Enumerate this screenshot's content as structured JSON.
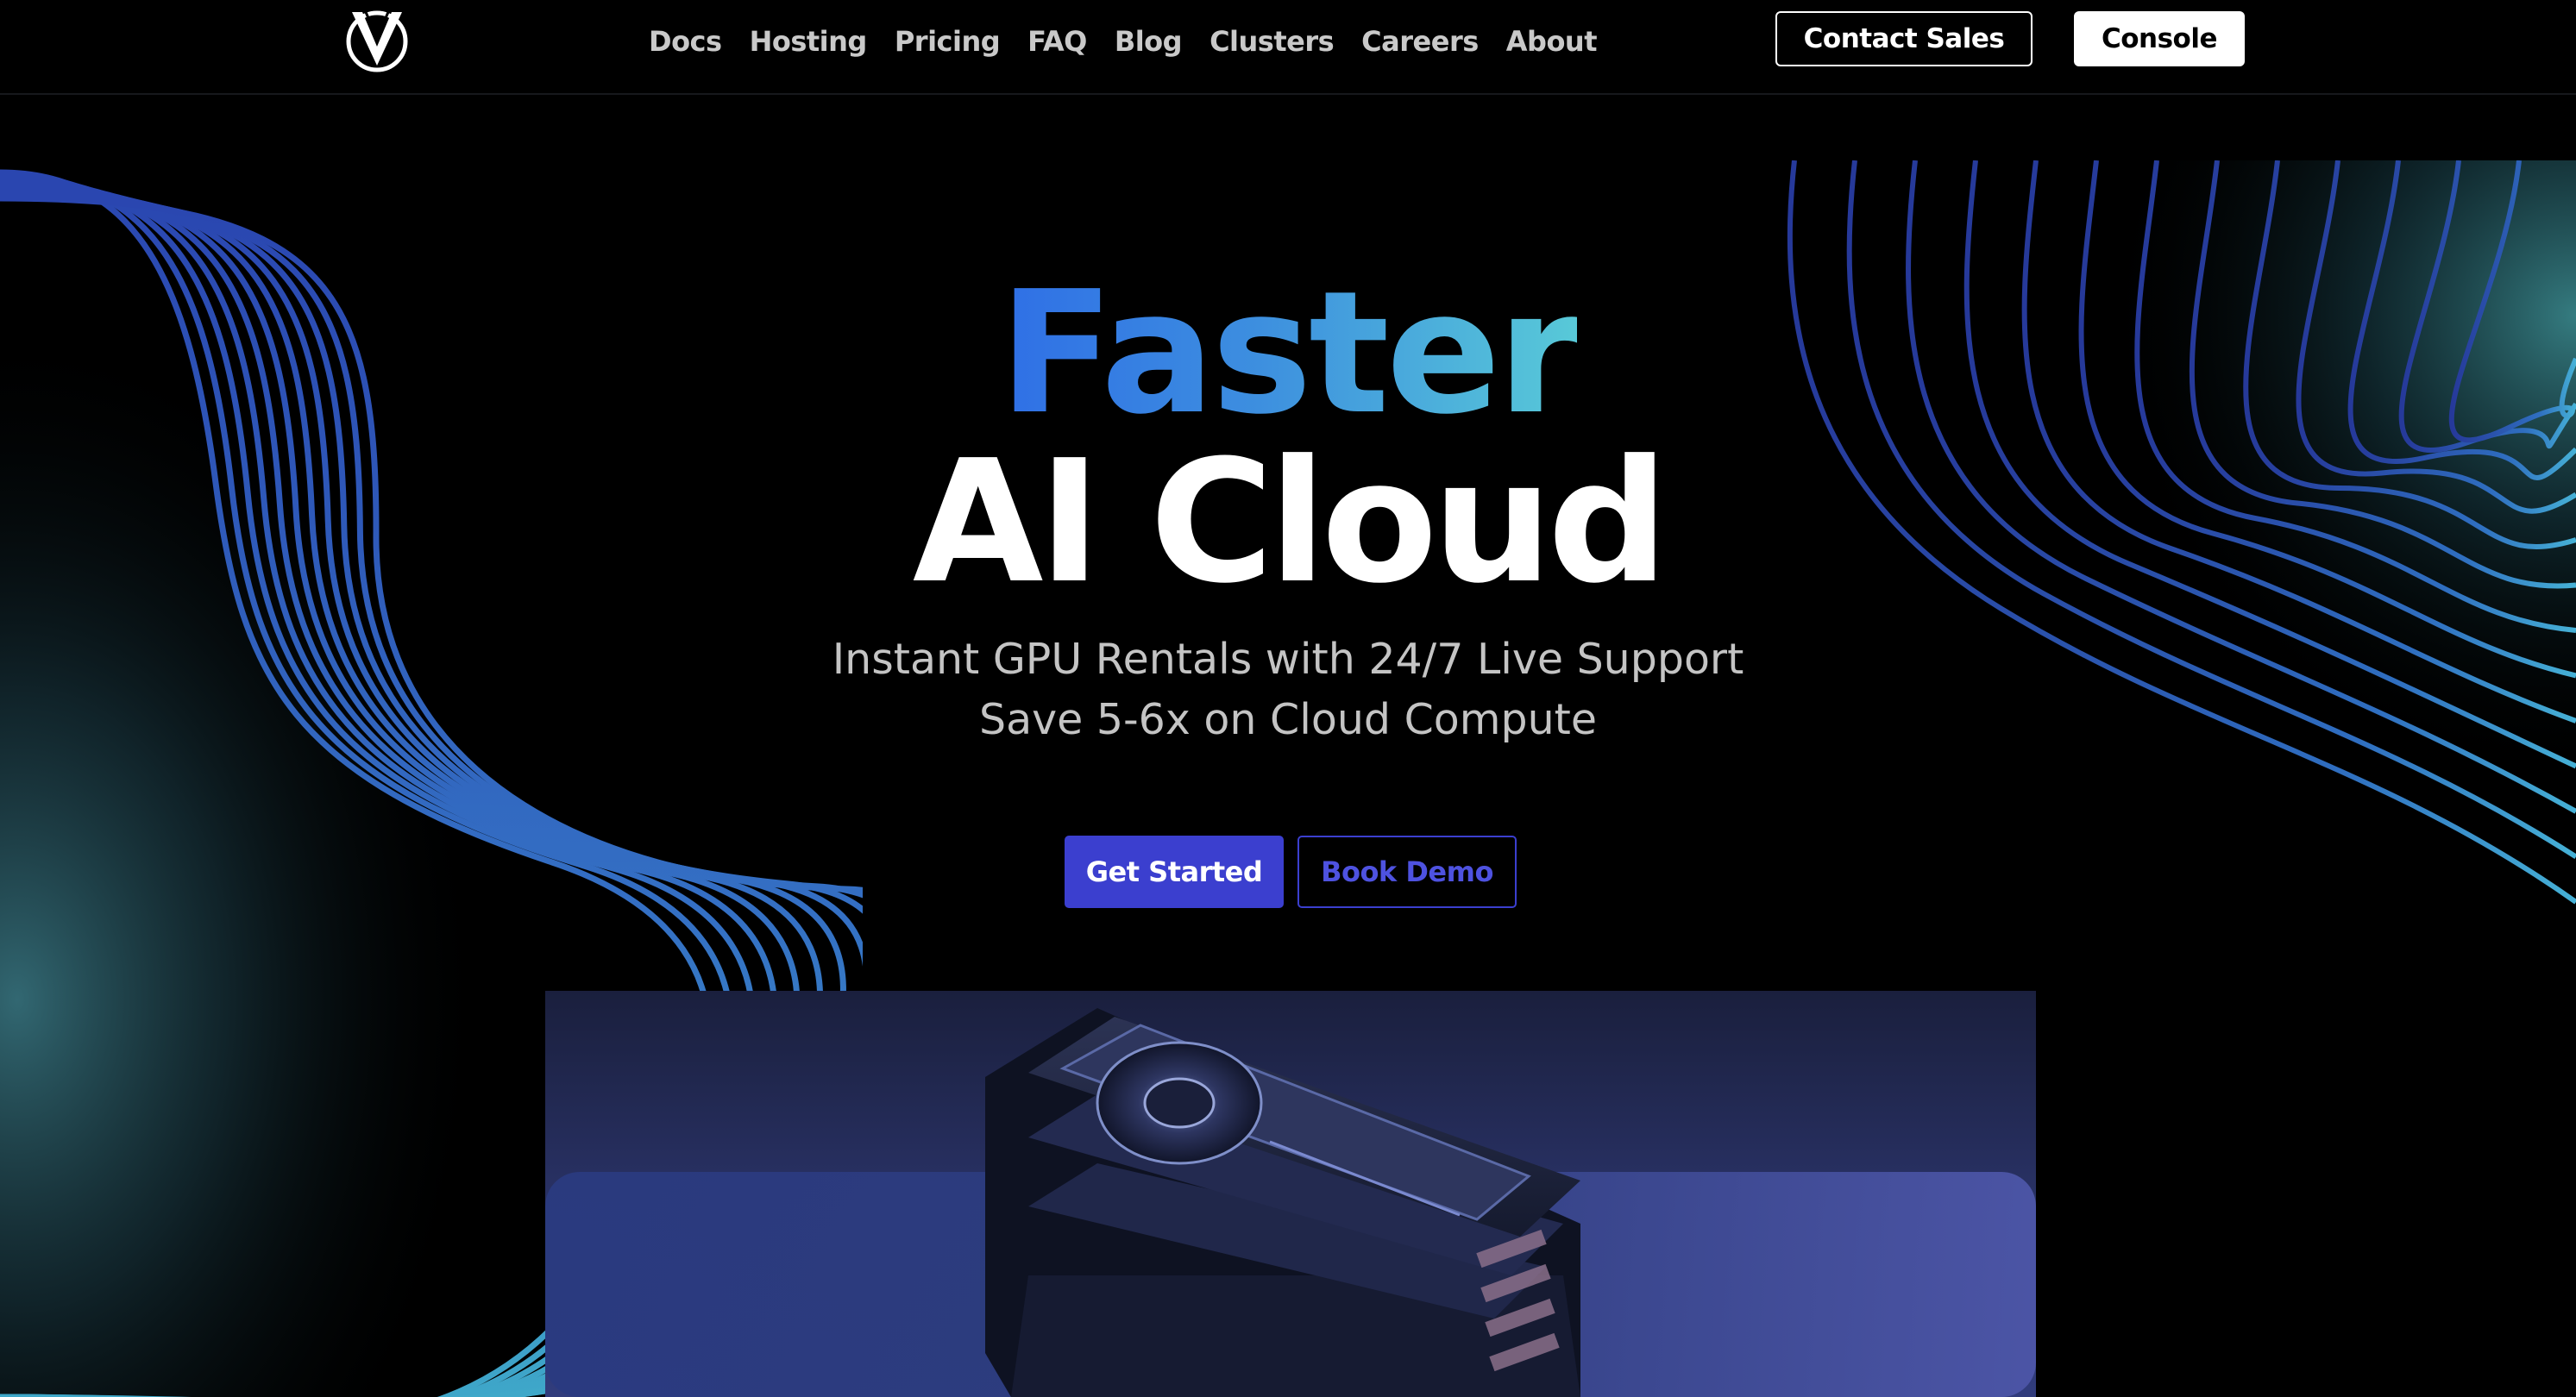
{
  "nav": {
    "links": [
      {
        "label": "Docs"
      },
      {
        "label": "Hosting"
      },
      {
        "label": "Pricing"
      },
      {
        "label": "FAQ"
      },
      {
        "label": "Blog"
      },
      {
        "label": "Clusters"
      },
      {
        "label": "Careers"
      },
      {
        "label": "About"
      }
    ],
    "contact_sales_label": "Contact Sales",
    "console_label": "Console",
    "logo_icon": "v-logo-icon"
  },
  "hero": {
    "title_line1": "Faster",
    "title_line2": "AI Cloud",
    "subtitle_line1": "Instant GPU Rentals with 24/7 Live Support",
    "subtitle_line2": "Save 5-6x on Cloud Compute",
    "get_started_label": "Get Started",
    "book_demo_label": "Book Demo",
    "image": "gpu-cards-stack-image"
  },
  "colors": {
    "background": "#000000",
    "accent": "#3b3fcf",
    "gradient_start": "#2f6fe6",
    "gradient_end": "#58c9d8",
    "wave_blue": "#2c49b8",
    "wave_teal": "#3fa9c9"
  }
}
